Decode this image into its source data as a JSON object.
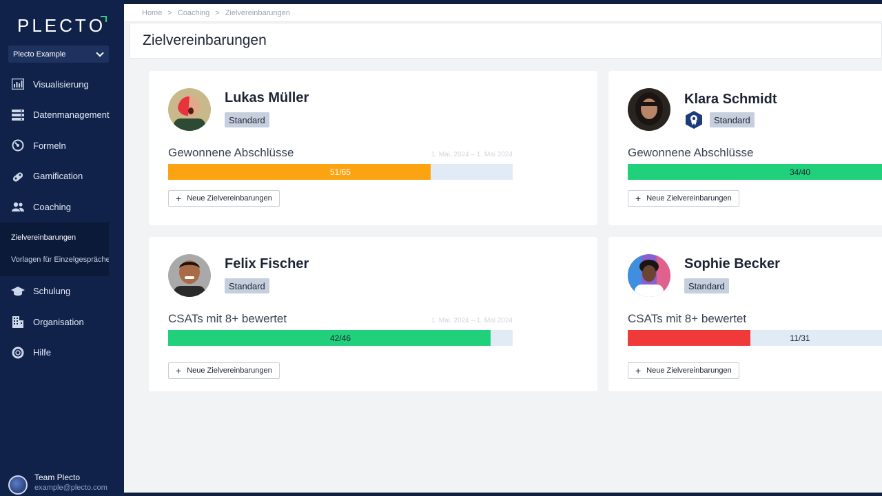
{
  "app": {
    "logo": "PLECT",
    "logo_last": "O"
  },
  "workspace": {
    "name": "Plecto Example"
  },
  "nav": [
    {
      "label": "Visualisierung",
      "icon": "chart-icon"
    },
    {
      "label": "Datenmanagement",
      "icon": "database-icon"
    },
    {
      "label": "Formeln",
      "icon": "gauge-icon"
    },
    {
      "label": "Gamification",
      "icon": "gamepad-icon"
    },
    {
      "label": "Coaching",
      "icon": "users-icon"
    }
  ],
  "subnav": [
    {
      "label": "Zielvereinbarungen",
      "active": true
    },
    {
      "label": "Vorlagen für Einzelgespräche",
      "active": false
    }
  ],
  "nav2": [
    {
      "label": "Schulung",
      "icon": "graduation-cap-icon"
    },
    {
      "label": "Organisation",
      "icon": "building-icon"
    },
    {
      "label": "Hilfe",
      "icon": "lifebuoy-icon"
    }
  ],
  "user": {
    "name": "Team Plecto",
    "email": "example@plecto.com"
  },
  "breadcrumb": {
    "home": "Home",
    "coaching": "Coaching",
    "current": "Zielvereinbarungen"
  },
  "page": {
    "title": "Zielvereinbarungen"
  },
  "cards": [
    {
      "name": "Lukas Müller",
      "badge": "Standard",
      "goal": "Gewonnene Abschlüsse",
      "date": "1. Mai, 2024 – 1. Mai 2024",
      "progress": "51/65",
      "fraction": 0.762,
      "color": "#fca311",
      "button": "Neue Zielvereinbarungen"
    },
    {
      "name": "Klara Schmidt",
      "badge": "Standard",
      "goal": "Gewonnene Abschlüsse",
      "date": "",
      "progress": "34/40",
      "fraction": 0.85,
      "color": "#21d07a",
      "button": "Neue Zielvereinbarungen"
    },
    {
      "name": "Felix Fischer",
      "badge": "Standard",
      "goal": "CSATs mit 8+ bewertet",
      "date": "1. Mai, 2024 – 1. Mai 2024",
      "progress": "42/46",
      "fraction": 0.936,
      "color": "#21d07a",
      "button": "Neue Zielvereinbarungen"
    },
    {
      "name": "Sophie Becker",
      "badge": "Standard",
      "goal": "CSATs mit 8+ bewertet",
      "date": "",
      "progress": "11/31",
      "fraction": 0.355,
      "color": "#f03a3a",
      "button": "Neue Zielvereinbarungen"
    }
  ]
}
